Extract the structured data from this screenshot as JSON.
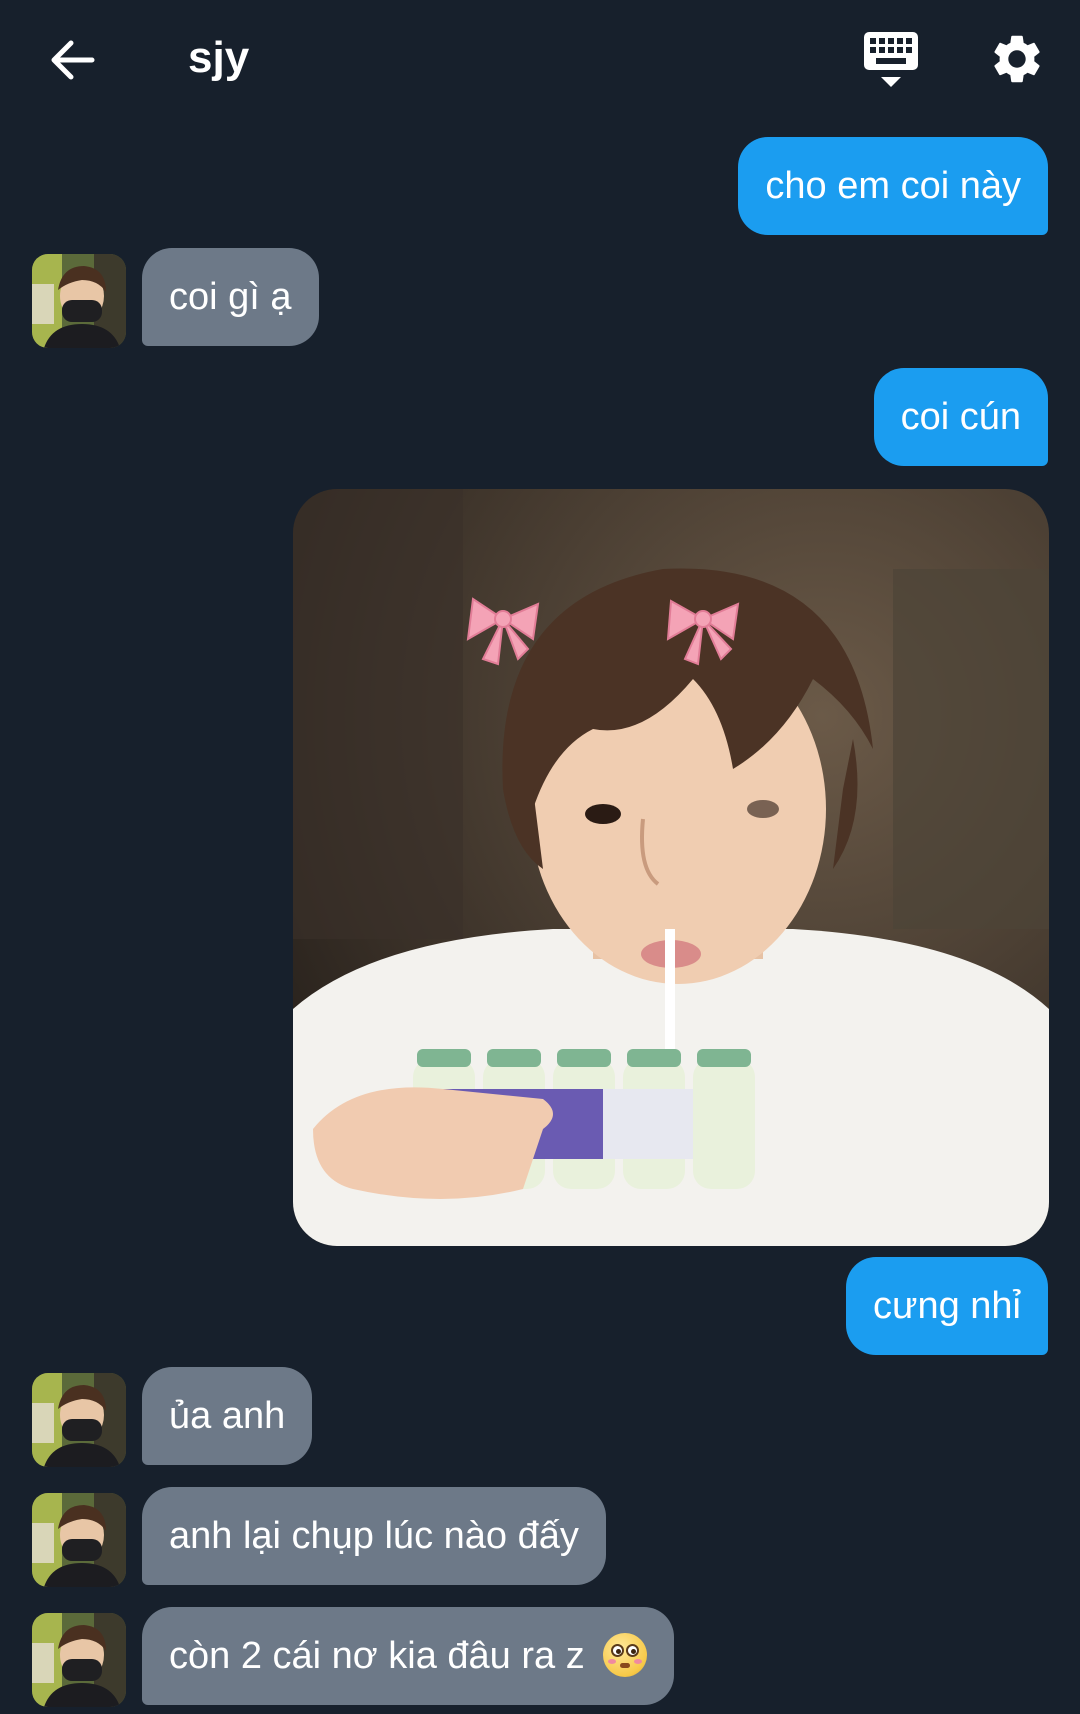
{
  "header": {
    "title": "sjy",
    "back_icon": "arrow-left-icon",
    "keyboard_icon": "keyboard-hide-icon",
    "settings_icon": "gear-icon"
  },
  "colors": {
    "background": "#17202c",
    "outgoing_bubble": "#1b9df0",
    "incoming_bubble": "#6d7988"
  },
  "messages": [
    {
      "from": "me",
      "text": "cho em coi này"
    },
    {
      "from": "them",
      "text": "coi gì ạ"
    },
    {
      "from": "me",
      "text": "coi cún"
    },
    {
      "from": "me",
      "type": "photo"
    },
    {
      "from": "me",
      "text": "cưng nhỉ"
    },
    {
      "from": "them",
      "text": "ủa anh"
    },
    {
      "from": "them",
      "text": "anh lại chụp lúc nào đấy"
    },
    {
      "from": "them",
      "text": "còn 2 cái nơ kia đâu ra z",
      "emoji": "flushed-face-emoji"
    }
  ]
}
